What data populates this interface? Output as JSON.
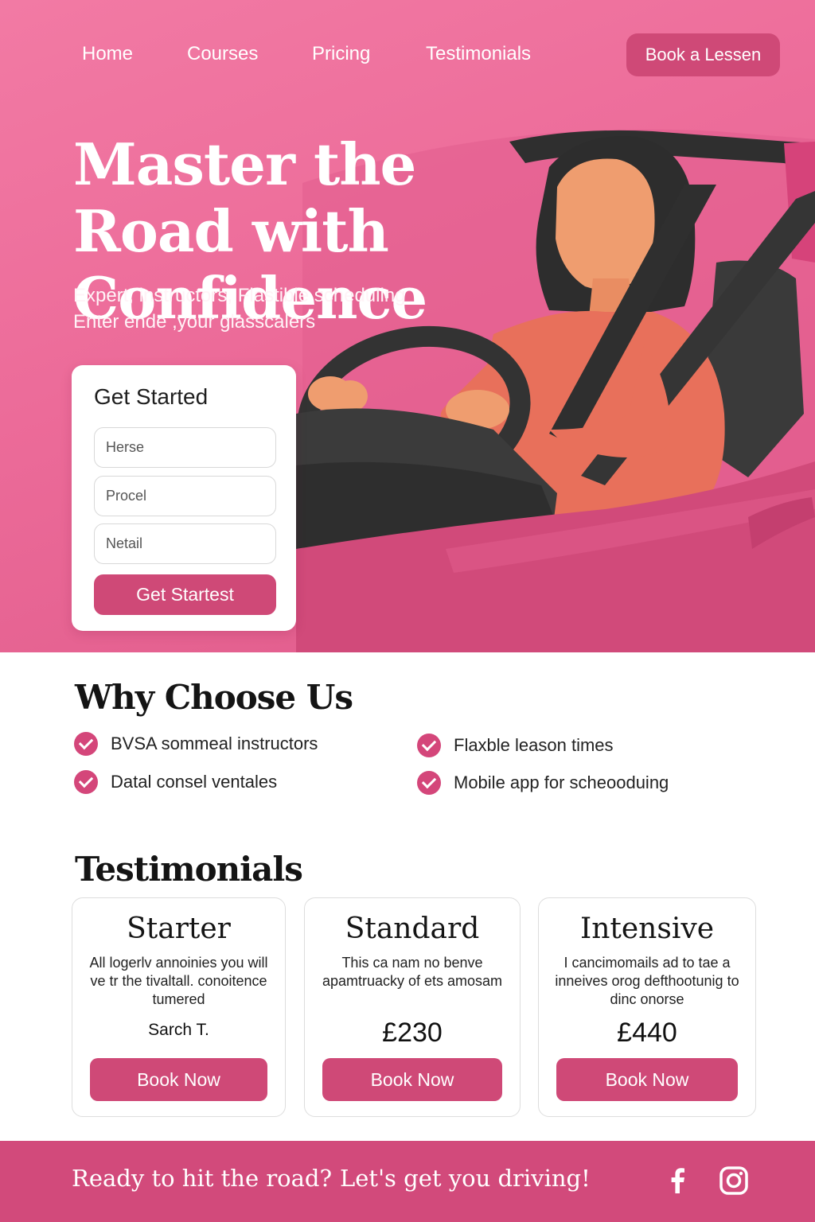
{
  "nav": {
    "links": [
      "Home",
      "Courses",
      "Pricing",
      "Testimonials"
    ],
    "cta_label": "Book a Lessen"
  },
  "hero": {
    "title": "Master the Road with Confidence",
    "subtitle_line1": "Expert, instructors, Flastible scheduling",
    "subtitle_line2": "Enter ende ,your glasscalers"
  },
  "form": {
    "title": "Get Started",
    "fields": [
      "Herse",
      "Procel",
      "Netail"
    ],
    "button_label": "Get Startest"
  },
  "why": {
    "title": "Why Choose Us",
    "features": [
      "BVSA sommeal instructors",
      "Flaxble leason times",
      "Datal consel ventales",
      "Mobile app for scheooduing"
    ]
  },
  "testimonials": {
    "title": "Testimonials",
    "cards": [
      {
        "title": "Starter",
        "desc": "All logerlv annoinies you will ve tr the tivaltall. conoitence tumered",
        "author": "Sarch T.",
        "button": "Book Now"
      },
      {
        "title": "Standard",
        "desc": "This ca nam no benve apamtruacky of ets amosam",
        "price": "£230",
        "button": "Book Now"
      },
      {
        "title": "Intensive",
        "desc": "I cancimomails ad to tae a inneives orog defthootunig to dinc onorse",
        "price": "£440",
        "button": "Book Now"
      }
    ]
  },
  "footer": {
    "text_left": "Ready to hit the road?",
    "text_right": "Let's get you driving!",
    "social_icons": [
      "facebook-icon",
      "instagram-icon"
    ]
  },
  "colors": {
    "brand_pink": "#ec6b99",
    "button_pink": "#cf4977",
    "footer_pink": "#d24a7b",
    "check_pink": "#d4467a"
  }
}
